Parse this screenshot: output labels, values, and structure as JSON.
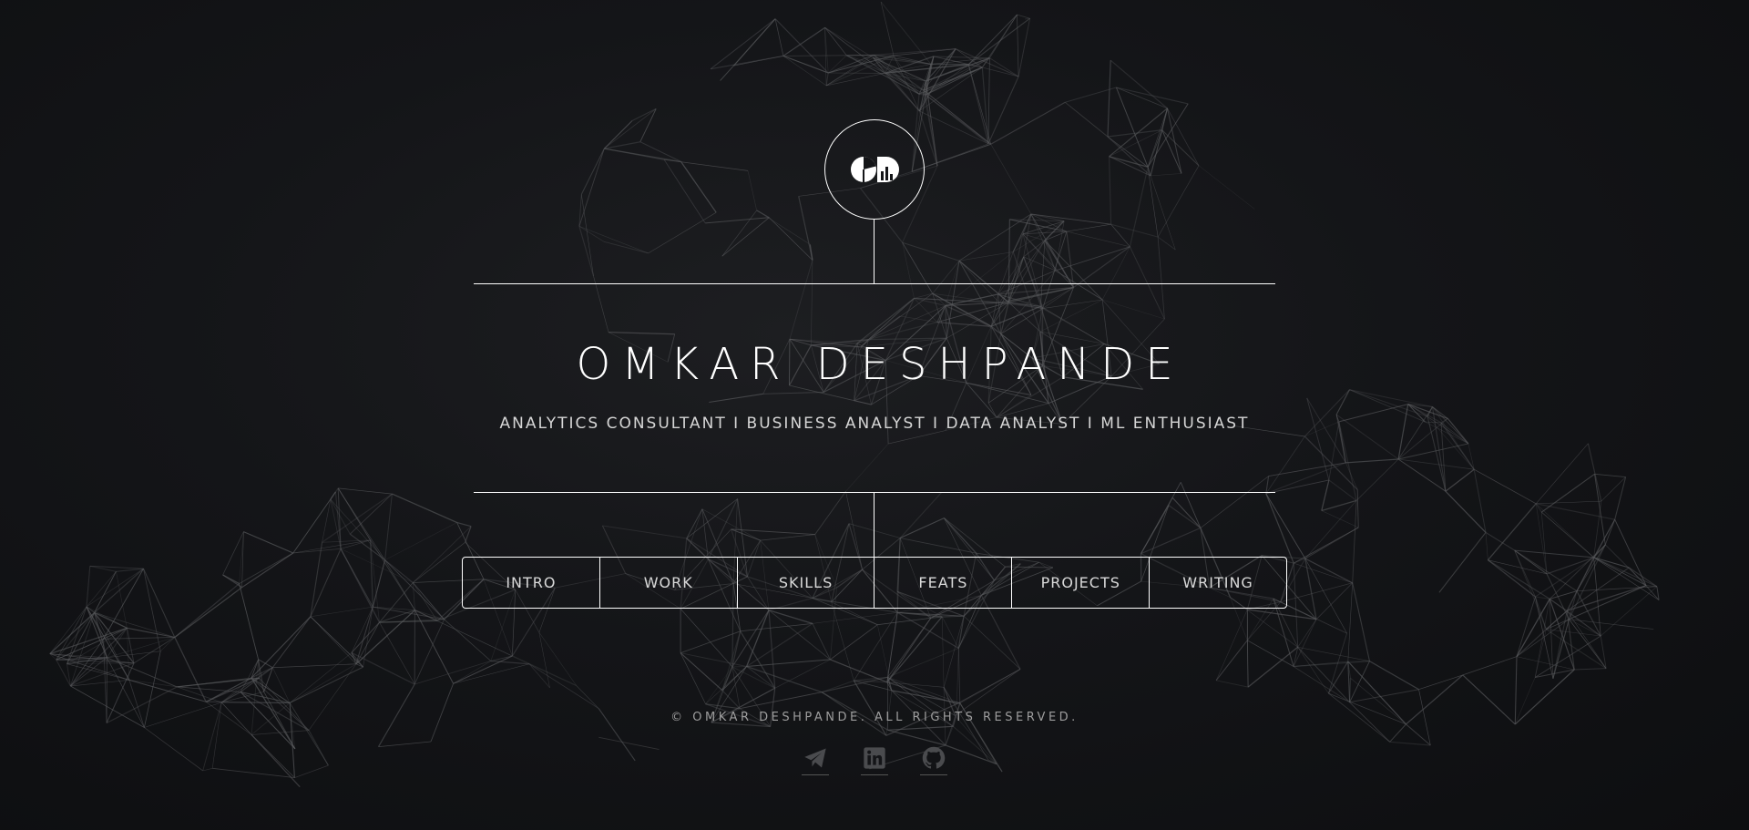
{
  "site": {
    "name": "OMKAR DESHPANDE",
    "tagline": "ANALYTICS CONSULTANT I BUSINESS ANALYST I DATA ANALYST I ML ENTHUSIAST"
  },
  "logo": {
    "icon": "od-logo-icon"
  },
  "nav": {
    "items": [
      {
        "label": "INTRO"
      },
      {
        "label": "WORK"
      },
      {
        "label": "SKILLS"
      },
      {
        "label": "FEATS"
      },
      {
        "label": "PROJECTS"
      },
      {
        "label": "WRITING"
      }
    ]
  },
  "footer": {
    "copyright": "© OMKAR DESHPANDE. ALL RIGHTS RESERVED.",
    "socials": [
      {
        "icon": "paper-plane-icon"
      },
      {
        "icon": "linkedin-icon"
      },
      {
        "icon": "github-icon"
      }
    ]
  },
  "colors": {
    "background": "#141518",
    "foreground": "#ffffff",
    "muted": "#9d9d9d",
    "mesh": "#5a5b5e"
  }
}
